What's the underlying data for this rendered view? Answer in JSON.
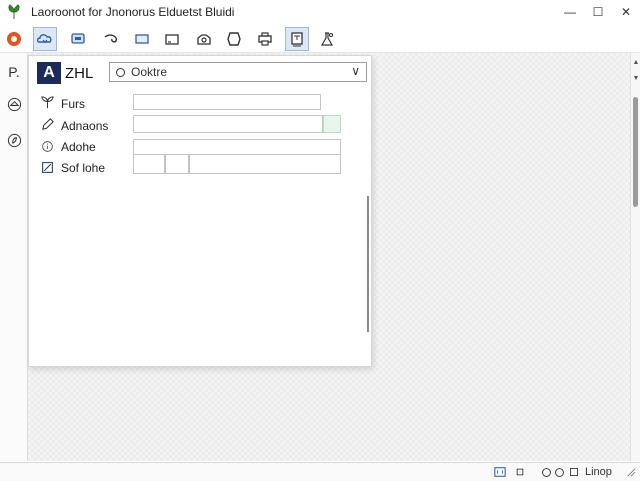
{
  "window": {
    "title": "Laoroonot for Jnonorus Elduetst Bluidi",
    "minimize": "—",
    "maximize": "☐",
    "close": "✕"
  },
  "toolbar": {
    "items": [
      {
        "icon": "record-icon"
      },
      {
        "icon": "cloud-sync-icon"
      },
      {
        "icon": "display-icon",
        "active": true
      },
      {
        "icon": "undo-curve-icon"
      },
      {
        "icon": "rectangle-icon"
      },
      {
        "icon": "frame-icon"
      },
      {
        "icon": "scan-icon"
      },
      {
        "icon": "shape-icon"
      },
      {
        "icon": "printer-icon"
      },
      {
        "icon": "page-icon",
        "active": true
      },
      {
        "icon": "flask-icon"
      }
    ]
  },
  "leftbar": {
    "items": [
      {
        "label": "P.",
        "icon": "text-tool"
      },
      {
        "icon": "layers-icon"
      },
      {
        "icon": "ink-icon"
      }
    ]
  },
  "panel": {
    "logo": "A",
    "name": "ZHL",
    "combo": {
      "value": "Ooktre"
    },
    "rows": [
      {
        "label": "Furs",
        "icon": "plant-icon"
      },
      {
        "label": "Adnaons",
        "icon": "pencil-icon"
      },
      {
        "label": "Adohe",
        "icon": "info-icon"
      },
      {
        "label": "Sof lohe",
        "icon": "edit-box-icon"
      }
    ]
  },
  "statusbar": {
    "zoom_label": "Linop",
    "icons": [
      "fit-icon",
      "small-view-icon",
      "circle-a-icon",
      "circle-b-icon",
      "grid-icon",
      "resize-grip-icon"
    ]
  },
  "colors": {
    "accent": "#1d2a5c",
    "record": "#e8501c",
    "app_icon": "#3b8b2f",
    "swatch": "#e6f6ea"
  }
}
